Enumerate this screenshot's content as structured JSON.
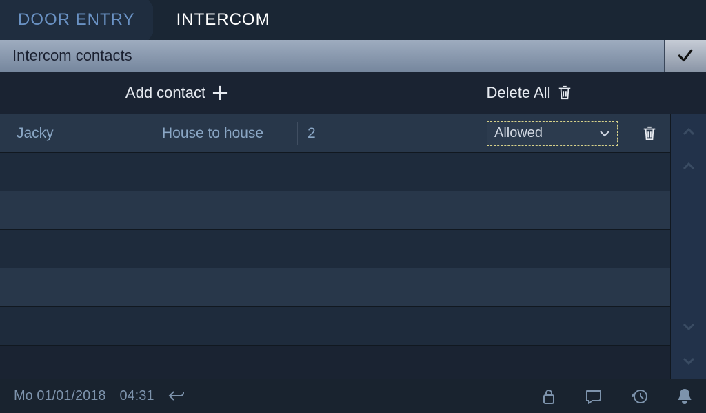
{
  "nav": {
    "inactive_tab": "DOOR ENTRY",
    "active_tab": "INTERCOM"
  },
  "title_bar": {
    "title": "Intercom contacts"
  },
  "actions": {
    "add_label": "Add contact",
    "delete_all_label": "Delete All"
  },
  "contacts": [
    {
      "name": "Jacky",
      "type": "House to house",
      "address": "2",
      "permission": "Allowed"
    }
  ],
  "status": {
    "date": "Mo 01/01/2018",
    "time": "04:31"
  }
}
